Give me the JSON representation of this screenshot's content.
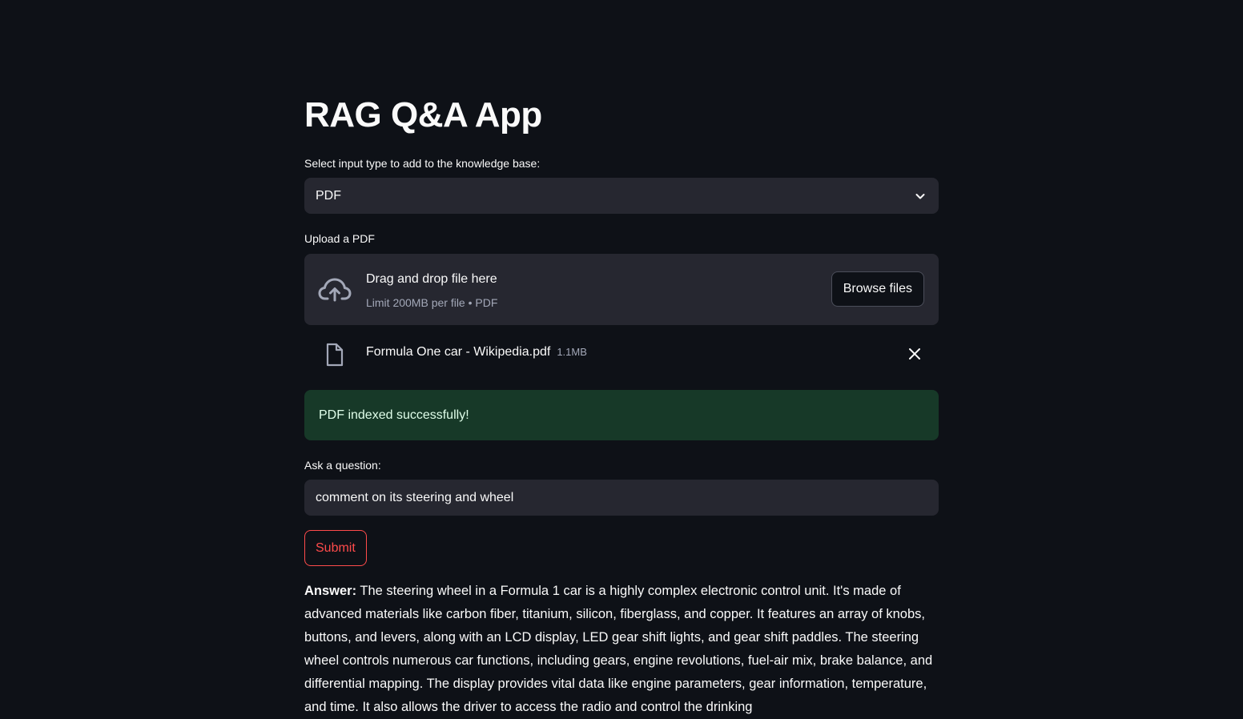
{
  "app": {
    "title": "RAG Q&A App"
  },
  "input_type": {
    "label": "Select input type to add to the knowledge base:",
    "selected": "PDF"
  },
  "uploader": {
    "label": "Upload a PDF",
    "drag_text": "Drag and drop file here",
    "limit_text": "Limit 200MB per file • PDF",
    "browse_label": "Browse files"
  },
  "uploaded_file": {
    "name": "Formula One car - Wikipedia.pdf",
    "size": "1.1MB"
  },
  "status": {
    "message": "PDF indexed successfully!",
    "color": "#173928"
  },
  "question": {
    "label": "Ask a question:",
    "value": "comment on its steering and wheel"
  },
  "submit": {
    "label": "Submit",
    "color": "#ff4b4b"
  },
  "answer": {
    "prefix": "Answer:",
    "text": "The steering wheel in a Formula 1 car is a highly complex electronic control unit. It's made of advanced materials like carbon fiber, titanium, silicon, fiberglass, and copper. It features an array of knobs, buttons, and levers, along with an LCD display, LED gear shift lights, and gear shift paddles. The steering wheel controls numerous car functions, including gears, engine revolutions, fuel-air mix, brake balance, and differential mapping. The display provides vital data like engine parameters, gear information, temperature, and time. It also allows the driver to access the radio and control the drinking"
  },
  "icons": {
    "select_arrow": "chevron-down-icon",
    "upload": "cloud-upload-icon",
    "file": "file-icon",
    "remove": "close-icon"
  },
  "theme": {
    "background": "#0e1117",
    "surface": "#262730",
    "text": "#fafafa",
    "muted": "#a3a8b8"
  }
}
